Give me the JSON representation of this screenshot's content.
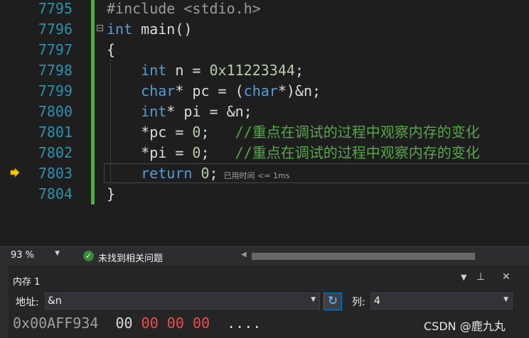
{
  "editor": {
    "lines": [
      {
        "number": "7795",
        "segments": [
          {
            "text": "#include <stdio.h>",
            "cls": "pp"
          }
        ]
      },
      {
        "number": "7796",
        "segments": [
          {
            "text": "int",
            "cls": "kw"
          },
          {
            "text": " main()",
            "cls": "id"
          }
        ]
      },
      {
        "number": "7797",
        "segments": [
          {
            "text": "{",
            "cls": "id"
          }
        ]
      },
      {
        "number": "7798",
        "segments": [
          {
            "text": "    ",
            "cls": "id"
          },
          {
            "text": "int",
            "cls": "kw"
          },
          {
            "text": " n = ",
            "cls": "id"
          },
          {
            "text": "0x11223344",
            "cls": "num"
          },
          {
            "text": ";",
            "cls": "id"
          }
        ]
      },
      {
        "number": "7799",
        "segments": [
          {
            "text": "    ",
            "cls": "id"
          },
          {
            "text": "char",
            "cls": "kw"
          },
          {
            "text": "* pc = (",
            "cls": "id"
          },
          {
            "text": "char",
            "cls": "kw"
          },
          {
            "text": "*)&n;",
            "cls": "id"
          }
        ]
      },
      {
        "number": "7800",
        "segments": [
          {
            "text": "    ",
            "cls": "id"
          },
          {
            "text": "int",
            "cls": "kw"
          },
          {
            "text": "* pi = &n;",
            "cls": "id"
          }
        ]
      },
      {
        "number": "7801",
        "segments": [
          {
            "text": "    *pc = ",
            "cls": "id"
          },
          {
            "text": "0",
            "cls": "num"
          },
          {
            "text": ";   ",
            "cls": "id"
          },
          {
            "text": "//重点在调试的过程中观察内存的变化",
            "cls": "cmt"
          }
        ]
      },
      {
        "number": "7802",
        "segments": [
          {
            "text": "    *pi = ",
            "cls": "id"
          },
          {
            "text": "0",
            "cls": "num"
          },
          {
            "text": ";   ",
            "cls": "id"
          },
          {
            "text": "//重点在调试的过程中观察内存的变化",
            "cls": "cmt"
          }
        ]
      },
      {
        "number": "7803",
        "segments": [
          {
            "text": "    ",
            "cls": "id"
          },
          {
            "text": "return",
            "cls": "kw"
          },
          {
            "text": " ",
            "cls": "id"
          },
          {
            "text": "0",
            "cls": "num"
          },
          {
            "text": ";",
            "cls": "id"
          }
        ],
        "perf_tip": "已用时间 <= 1ms"
      },
      {
        "number": "7804",
        "segments": [
          {
            "text": "}",
            "cls": "id"
          }
        ]
      }
    ]
  },
  "statusbar": {
    "zoom": "93 %",
    "issues": "未找到相关问题"
  },
  "memory_panel": {
    "title": "内存 1",
    "address_label": "地址:",
    "address_value": "&n",
    "columns_label": "列:",
    "columns_value": "4",
    "row": {
      "address": "0x00AFF934",
      "bytes": [
        {
          "value": "00",
          "changed": false
        },
        {
          "value": "00",
          "changed": true
        },
        {
          "value": "00",
          "changed": true
        },
        {
          "value": "00",
          "changed": true
        }
      ],
      "ascii": "...."
    }
  },
  "watermark": "CSDN @鹿九丸",
  "colors": {
    "keyword": "#569cd6",
    "line_number": "#2b91af",
    "comment": "#57a64a",
    "number": "#b5cea8",
    "changed_byte": "#f14c4c",
    "accent": "#007acc"
  },
  "icons": {
    "current_statement": "yellow-arrow-icon",
    "no_issues": "check-circle-icon",
    "refresh": "refresh-icon"
  }
}
